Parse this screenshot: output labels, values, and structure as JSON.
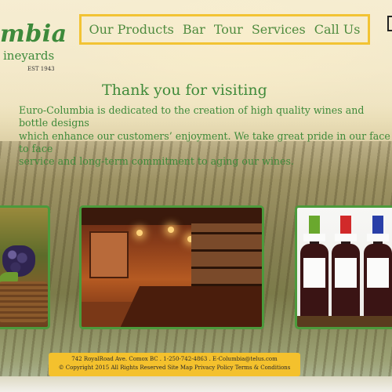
{
  "logo": {
    "name": "mbia",
    "sub": "ineyards",
    "est": "EST 1943"
  },
  "nav": {
    "items": [
      {
        "label": "Our Products"
      },
      {
        "label": "Bar"
      },
      {
        "label": "Tour"
      },
      {
        "label": "Services"
      },
      {
        "label": "Call Us"
      }
    ]
  },
  "main": {
    "heading": "Thank you for visiting",
    "intro": "Euro-Columbia is dedicated to the creation of high quality wines and bottle designs\nwhich enhance our customers’ enjoyment. We take great pride in our face to face\nservice and long-term commitment to aging our wines."
  },
  "photos": {
    "grapes": "grapes-basket-image",
    "bar": "bar-interior-image",
    "wine": "wine-bottles-image",
    "bottle_cap_colors": [
      "#6aa82e",
      "#d12a2a",
      "#2a3fa8"
    ]
  },
  "footer": {
    "address": "742 RoyalRoad Ave. Comox BC .  1-250-742-4863 .  E-Columbia@telus.com",
    "copyright": "© Copyright 2015 All Rights Reserved",
    "links": [
      "Site Map",
      "Privacy Policy",
      "Terms & Conditions"
    ]
  },
  "colors": {
    "brand_green": "#3d8a3b",
    "nav_border": "#f2c333",
    "footer_bg": "#f4c12d",
    "photo_border": "#4c9a3c"
  }
}
